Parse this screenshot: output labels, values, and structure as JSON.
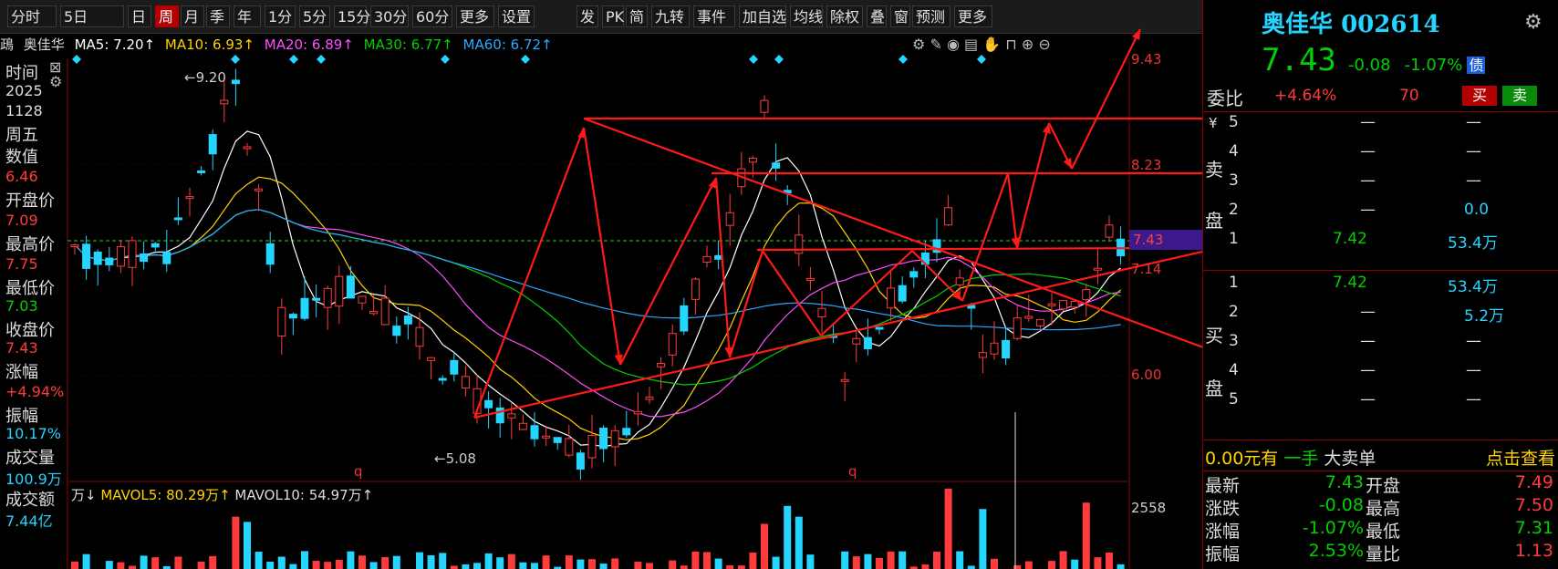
{
  "toolbar": {
    "items": [
      "分时",
      "5日",
      "日",
      "周",
      "月",
      "季",
      "年",
      "1分",
      "5分",
      "15分",
      "30分",
      "60分",
      "更多",
      "设置",
      "发",
      "PK",
      "简",
      "九转",
      "事件",
      "加自选",
      "均线",
      "除权",
      "叠",
      "窗",
      "预测",
      "更多"
    ],
    "active_index": 3
  },
  "ma_bar": {
    "prefix": "鴊",
    "name": "奥佳华",
    "ma5": "MA5: 7.20↑",
    "ma10": "MA10: 6.93↑",
    "ma20": "MA20: 6.89↑",
    "ma30": "MA30: 6.77↑",
    "ma60": "MA60: 6.72↑"
  },
  "left": {
    "time_label": "时间",
    "year": "2025",
    "date": "1128",
    "weekday": "周五",
    "value_label": "数值",
    "value": "6.46",
    "open_label": "开盘价",
    "open": "7.09",
    "high_label": "最高价",
    "high": "7.75",
    "low_label": "最低价",
    "low": "7.03",
    "close_label": "收盘价",
    "close": "7.43",
    "change_label": "涨幅",
    "change": "+4.94%",
    "amp_label": "振幅",
    "amp": "10.17%",
    "vol_label": "成交量",
    "vol": "100.9万",
    "amount_label": "成交额",
    "amount": "7.44亿"
  },
  "chart": {
    "high_mark": "9.20",
    "low_mark": "5.08",
    "axis": [
      "9.43",
      "8.23",
      "7.43",
      "7.14",
      "6.00",
      "2558"
    ],
    "current_price": "7.43",
    "q_marks": [
      "q",
      "q"
    ],
    "vol_bar": {
      "unit": "万↓",
      "mavol5": "MAVOL5: 80.29万↑",
      "mavol10": "MAVOL10: 54.97万↑"
    }
  },
  "right": {
    "name": "奥佳华",
    "code": "002614",
    "price": "7.43",
    "chg": "-0.08",
    "chg_pct": "-1.07%",
    "bond": "债",
    "weibi_label": "委比",
    "weibi": "+4.64%",
    "weicha": "70",
    "buy_btn": "买",
    "sell_btn": "卖",
    "yen": "¥",
    "sell_label": [
      "卖",
      "盘"
    ],
    "buy_label": [
      "买",
      "盘"
    ],
    "sell_rows": [
      {
        "n": "5",
        "p": "—",
        "v": "—"
      },
      {
        "n": "4",
        "p": "—",
        "v": "—"
      },
      {
        "n": "3",
        "p": "—",
        "v": "—"
      },
      {
        "n": "2",
        "p": "—",
        "v": "0.0"
      },
      {
        "n": "1",
        "p": "7.42",
        "v": "53.4万"
      }
    ],
    "buy_rows": [
      {
        "n": "1",
        "p": "7.42",
        "v": "53.4万"
      },
      {
        "n": "2",
        "p": "—",
        "v": "5.2万"
      },
      {
        "n": "3",
        "p": "—",
        "v": "—"
      },
      {
        "n": "4",
        "p": "—",
        "v": "—"
      },
      {
        "n": "5",
        "p": "—",
        "v": "—"
      }
    ],
    "big_order": {
      "amount": "0.00元有",
      "hand": "一手",
      "label": "大卖单",
      "link": "点击查看"
    },
    "stats": [
      {
        "l": "最新",
        "v": "7.43",
        "l2": "开盘",
        "v2": "7.49"
      },
      {
        "l": "涨跌",
        "v": "-0.08",
        "l2": "最高",
        "v2": "7.50"
      },
      {
        "l": "涨幅",
        "v": "-1.07%",
        "l2": "最低",
        "v2": "7.31"
      },
      {
        "l": "振幅",
        "v": "2.53%",
        "l2": "量比",
        "v2": "1.13"
      }
    ]
  },
  "colors": {
    "up": "#ff3b3b",
    "down": "#23d5ff",
    "ma5": "#ffffff",
    "ma10": "#ffd400",
    "ma20": "#ff4dff",
    "ma30": "#00d000",
    "ma60": "#2aa9ff",
    "trend": "#ff1a1a"
  }
}
